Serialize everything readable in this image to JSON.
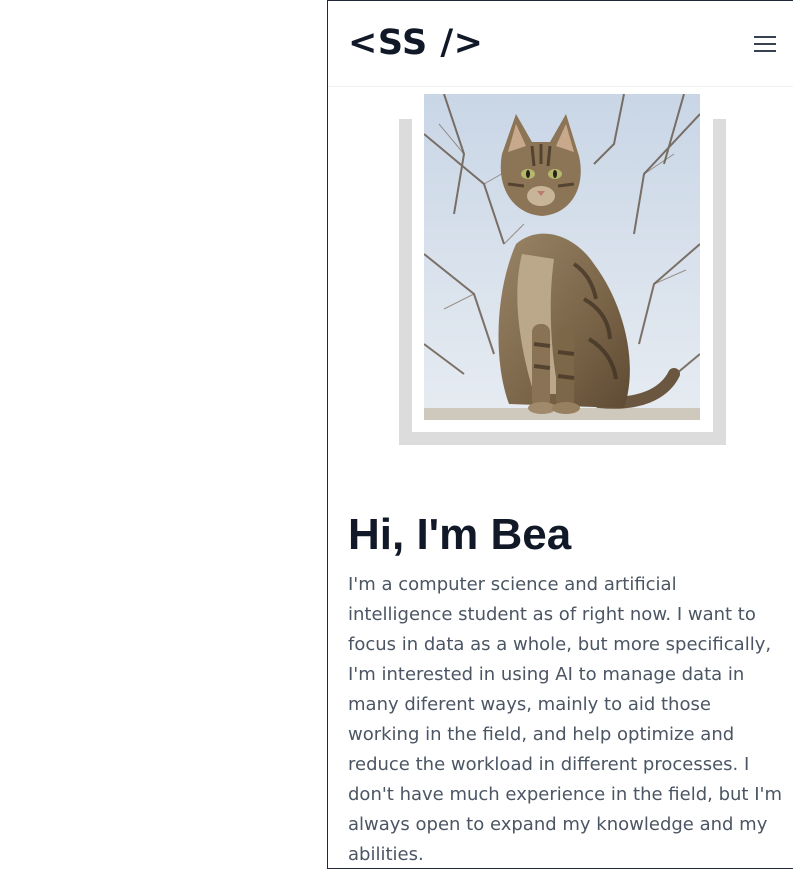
{
  "header": {
    "logo": "<SS />",
    "menu_icon": "hamburger-menu-icon"
  },
  "hero": {
    "image_subject": "tabby cat sitting outdoors",
    "title": "Hi, I'm Bea",
    "bio": "I'm a computer science and artificial intelligence student as of right now. I want to focus in data as a whole, but more specifically, I'm interested in using AI to manage data in many diferent ways, mainly to aid those working in the field, and help optimize and reduce the workload in different processes. I don't have much experience in the field, but I'm always open to expand my knowledge and my abilities."
  },
  "colors": {
    "text_dark": "#111827",
    "text_body": "#4b5563",
    "frame_shadow": "#dcdcdc"
  }
}
